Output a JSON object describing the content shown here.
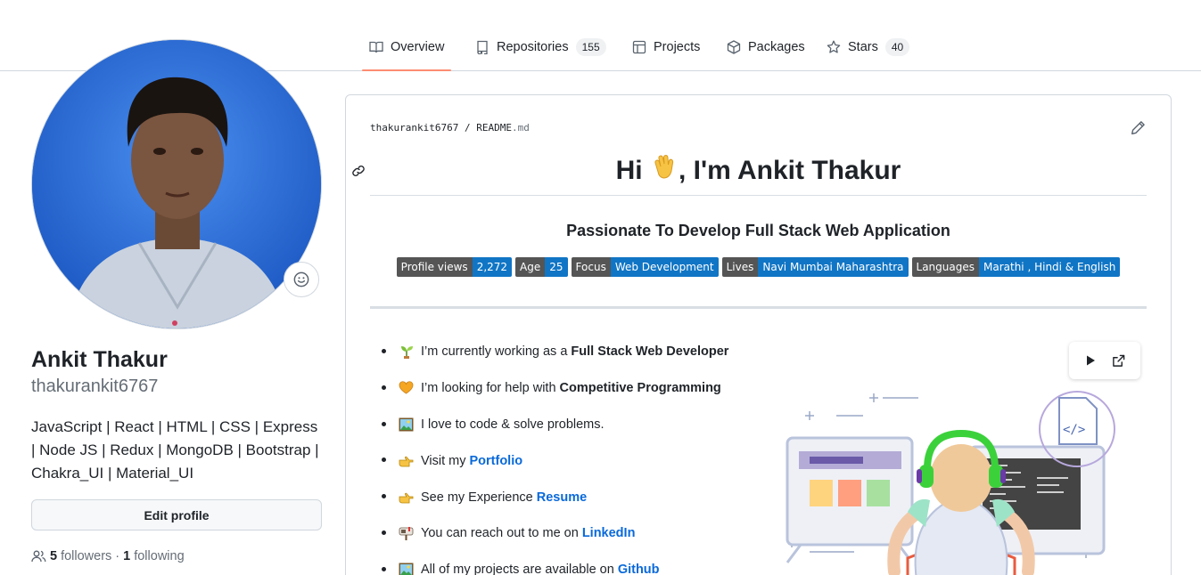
{
  "nav": {
    "tabs": [
      {
        "label": "Overview",
        "icon": "book-icon",
        "active": true
      },
      {
        "label": "Repositories",
        "icon": "repo-icon",
        "count": "155"
      },
      {
        "label": "Projects",
        "icon": "table-icon"
      },
      {
        "label": "Packages",
        "icon": "package-icon"
      },
      {
        "label": "Stars",
        "icon": "star-icon",
        "count": "40"
      }
    ]
  },
  "profile": {
    "name": "Ankit Thakur",
    "login": "thakurankit6767",
    "bio": "JavaScript | React | HTML | CSS | Express | Node JS | Redux | MongoDB | Bootstrap | Chakra_UI | Material_UI",
    "edit_label": "Edit profile",
    "followers_count": "5",
    "followers_label": "followers",
    "separator": "·",
    "following_count": "1",
    "following_label": "following"
  },
  "readme": {
    "crumb_owner": "thakurankit6767",
    "crumb_sep": "/",
    "crumb_file": "README",
    "crumb_ext": ".md",
    "heading_pre": "Hi ",
    "heading_post": ", I'm Ankit Thakur",
    "tagline": "Passionate To Develop Full Stack Web Application",
    "badges": [
      {
        "label": "Profile views",
        "value": "2,272"
      },
      {
        "label": "Age",
        "value": "25"
      },
      {
        "label": "Focus",
        "value": "Web Development"
      },
      {
        "label": "Lives",
        "value": "Navi Mumbai Maharashtra"
      },
      {
        "label": "Languages",
        "value": "Marathi , Hindi & English"
      }
    ],
    "items": [
      {
        "emoji": "seedling-icon",
        "text": "I’m currently working as a",
        "bold": "Full Stack Web Developer"
      },
      {
        "emoji": "heart-icon",
        "text": "I’m looking for help with",
        "bold": "Competitive Programming"
      },
      {
        "emoji": "picture-icon",
        "text": "I love to code & solve problems."
      },
      {
        "emoji": "pointing-hand-icon",
        "text": "Visit my",
        "link": "Portfolio"
      },
      {
        "emoji": "pointing-hand-icon",
        "text": "See my Experience",
        "link": "Resume"
      },
      {
        "emoji": "mailbox-icon",
        "text": "You can reach out to me on",
        "link": "LinkedIn"
      },
      {
        "emoji": "picture-icon",
        "text": "All of my projects are available on",
        "link": "Github"
      }
    ]
  },
  "colors": {
    "accent_underline": "#fd8c73",
    "link": "#0969da",
    "badge_left": "#555555",
    "badge_right": "#1075c5"
  }
}
